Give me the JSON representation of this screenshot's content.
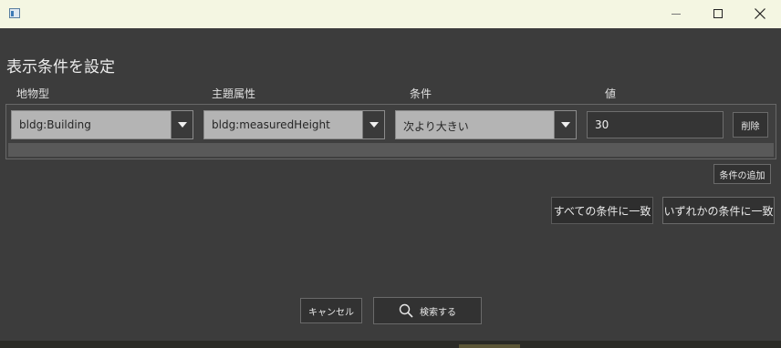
{
  "dialog": {
    "title": "表示条件を設定"
  },
  "columns": [
    "地物型",
    "主題属性",
    "条件",
    "値"
  ],
  "condition_rows": [
    {
      "feature_type": "bldg:Building",
      "attribute": "bldg:measuredHeight",
      "operator": "次より大きい",
      "value": "30",
      "delete_label": "削除"
    }
  ],
  "buttons": {
    "add_condition": "条件の追加",
    "match_all": "すべての条件に一致",
    "match_any": "いずれかの条件に一致",
    "cancel": "キャンセル",
    "search": "検索する"
  },
  "icons": {
    "app": "window-app-icon",
    "minimize": "minimize-icon",
    "maximize": "maximize-icon",
    "close": "close-icon",
    "dropdown": "chevron-down-icon",
    "search": "search-icon"
  },
  "colors": {
    "titlebar": "#f4f6e2",
    "background": "#3c3c3c",
    "combo_field": "#b4b4b4",
    "button": "#323232"
  }
}
